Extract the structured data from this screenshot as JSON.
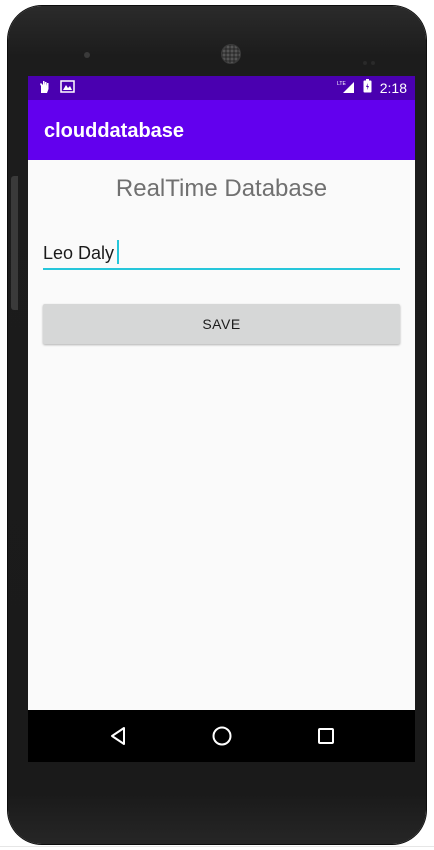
{
  "status_bar": {
    "time": "2:18",
    "network": "LTE",
    "icons": [
      "hand-icon",
      "gallery-icon",
      "signal-icon",
      "battery-icon"
    ]
  },
  "app_bar": {
    "title": "clouddatabase"
  },
  "main": {
    "heading": "RealTime Database",
    "name_input": {
      "value": "Leo Daly",
      "placeholder": ""
    },
    "save_button": {
      "label": "SAVE"
    }
  },
  "navigation": {
    "back_icon": "back-triangle-icon",
    "home_icon": "home-circle-icon",
    "recent_icon": "recent-square-icon"
  },
  "colors": {
    "status_bar": "#4a00b0",
    "app_bar": "#6200ee",
    "accent": "#26c6da",
    "button_bg": "#d6d7d7",
    "screen_bg": "#fafafa"
  }
}
